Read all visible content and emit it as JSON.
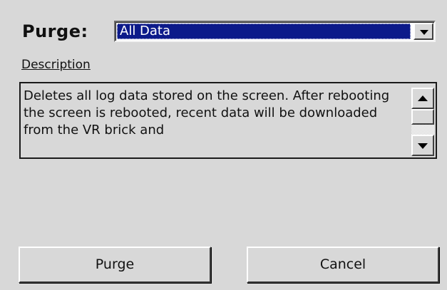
{
  "dialog": {
    "purge_label": "Purge:",
    "select": {
      "value": "All Data"
    },
    "description_header": "Description",
    "description_text": "Deletes all log data stored on the screen.   After rebooting the screen is rebooted, recent data will be downloaded from the VR brick and",
    "buttons": {
      "purge": "Purge",
      "cancel": "Cancel"
    }
  },
  "icons": {
    "dropdown": "chevron-down-icon",
    "scroll_up": "arrow-up-icon",
    "scroll_down": "arrow-down-icon"
  },
  "colors": {
    "dialog_bg": "#d8d8d8",
    "selection_bg": "#0c1a8a",
    "selection_text": "#ffffff"
  }
}
